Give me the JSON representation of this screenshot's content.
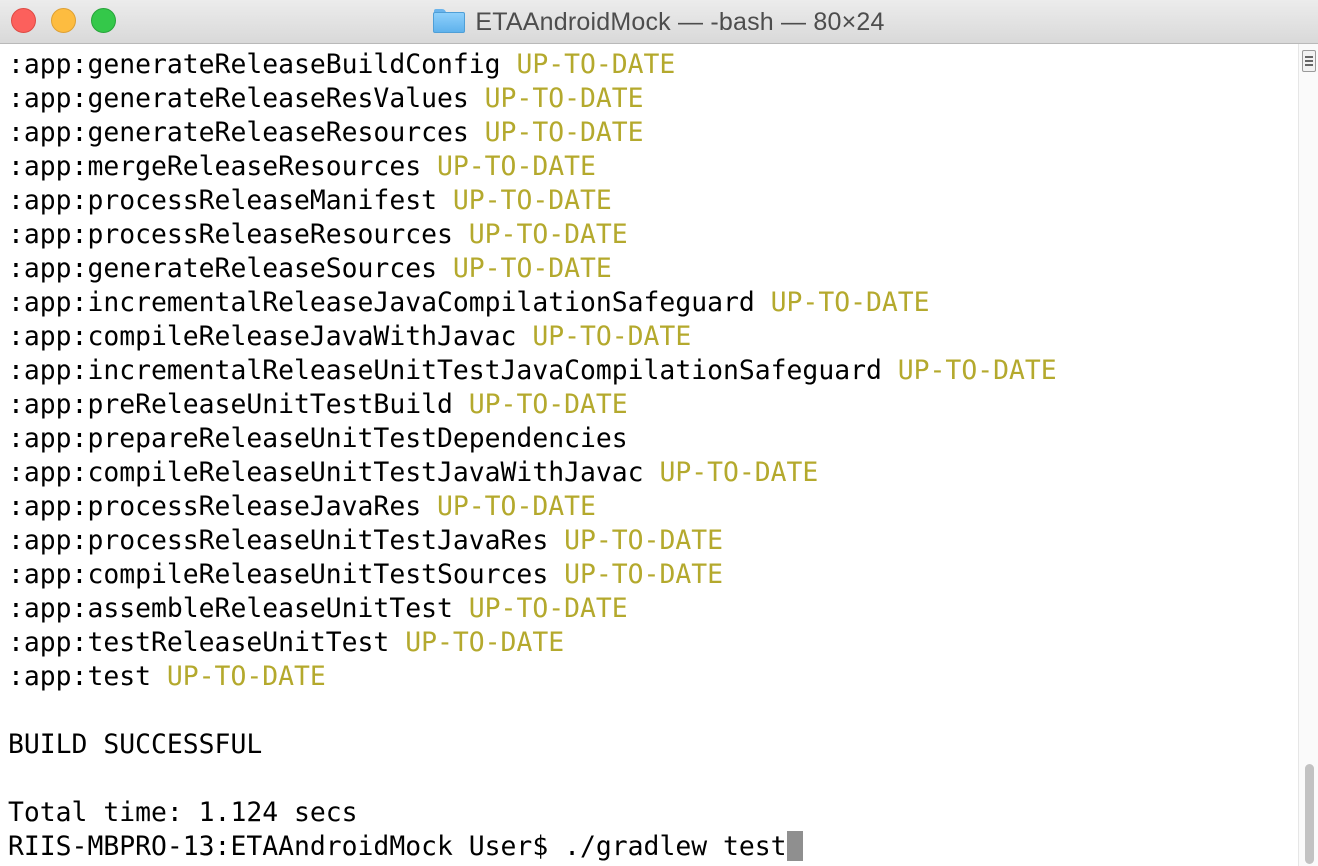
{
  "window": {
    "title": "ETAAndroidMock — -bash — 80×24",
    "folder_icon": "folder-icon"
  },
  "colors": {
    "status": "#b4a92d",
    "text": "#000000",
    "cursor": "#8f8f8f"
  },
  "terminal": {
    "lines": [
      {
        "text": ":app:generateReleaseBuildConfig ",
        "status": "UP-TO-DATE"
      },
      {
        "text": ":app:generateReleaseResValues ",
        "status": "UP-TO-DATE"
      },
      {
        "text": ":app:generateReleaseResources ",
        "status": "UP-TO-DATE"
      },
      {
        "text": ":app:mergeReleaseResources ",
        "status": "UP-TO-DATE"
      },
      {
        "text": ":app:processReleaseManifest ",
        "status": "UP-TO-DATE"
      },
      {
        "text": ":app:processReleaseResources ",
        "status": "UP-TO-DATE"
      },
      {
        "text": ":app:generateReleaseSources ",
        "status": "UP-TO-DATE"
      },
      {
        "text": ":app:incrementalReleaseJavaCompilationSafeguard ",
        "status": "UP-TO-DATE"
      },
      {
        "text": ":app:compileReleaseJavaWithJavac ",
        "status": "UP-TO-DATE"
      },
      {
        "text": ":app:incrementalReleaseUnitTestJavaCompilationSafeguard ",
        "status": "UP-TO-DATE"
      },
      {
        "text": ":app:preReleaseUnitTestBuild ",
        "status": "UP-TO-DATE"
      },
      {
        "text": ":app:prepareReleaseUnitTestDependencies",
        "status": ""
      },
      {
        "text": ":app:compileReleaseUnitTestJavaWithJavac ",
        "status": "UP-TO-DATE"
      },
      {
        "text": ":app:processReleaseJavaRes ",
        "status": "UP-TO-DATE"
      },
      {
        "text": ":app:processReleaseUnitTestJavaRes ",
        "status": "UP-TO-DATE"
      },
      {
        "text": ":app:compileReleaseUnitTestSources ",
        "status": "UP-TO-DATE"
      },
      {
        "text": ":app:assembleReleaseUnitTest ",
        "status": "UP-TO-DATE"
      },
      {
        "text": ":app:testReleaseUnitTest ",
        "status": "UP-TO-DATE"
      },
      {
        "text": ":app:test ",
        "status": "UP-TO-DATE"
      },
      {
        "text": "",
        "status": ""
      },
      {
        "text": "BUILD SUCCESSFUL",
        "status": ""
      },
      {
        "text": "",
        "status": ""
      },
      {
        "text": "Total time: 1.124 secs",
        "status": ""
      }
    ],
    "prompt": "RIIS-MBPRO-13:ETAAndroidMock User$ ",
    "command": "./gradlew test"
  }
}
